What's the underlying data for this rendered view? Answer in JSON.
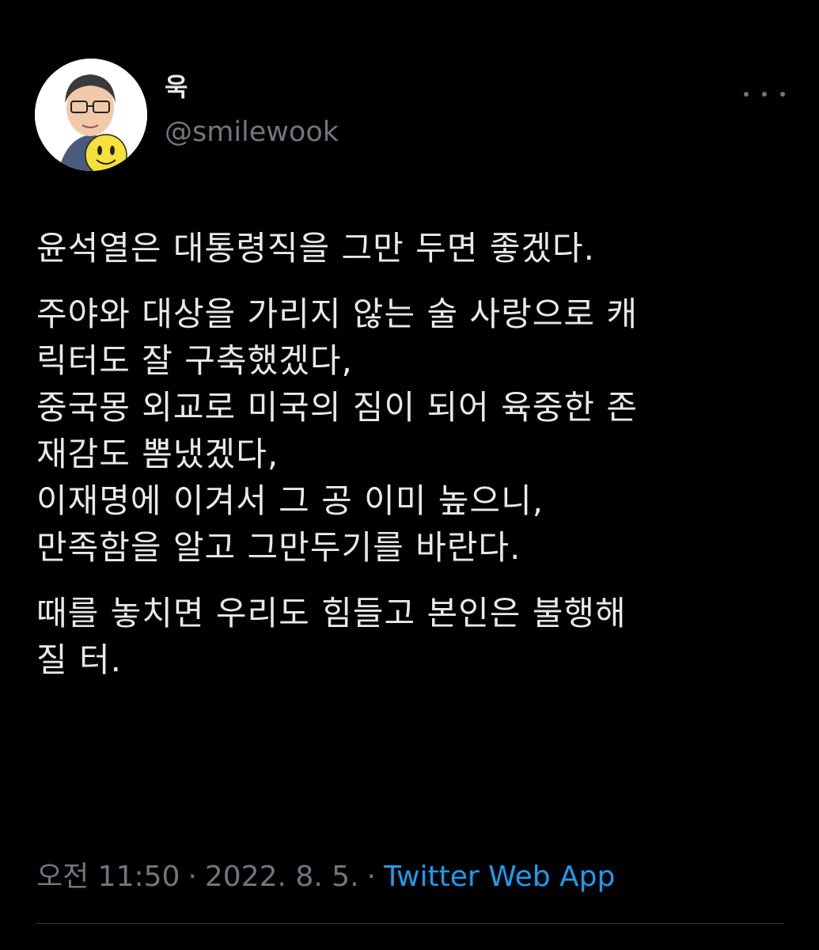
{
  "author": {
    "display_name": "욱",
    "handle": "@smilewook"
  },
  "more_icon": "ellipsis-icon",
  "tweet": {
    "paragraphs": [
      {
        "lines": [
          "윤석열은 대통령직을 그만 두면 좋겠다."
        ]
      },
      {
        "lines": [
          "주야와 대상을 가리지 않는 술 사랑으로 캐",
          "릭터도 잘 구축했겠다,",
          "중국몽 외교로 미국의 짐이 되어 육중한 존",
          "재감도 뽐냈겠다,",
          "이재명에 이겨서 그 공 이미 높으니,",
          "만족함을 알고 그만두기를 바란다."
        ]
      },
      {
        "lines": [
          "때를 놓치면 우리도 힘들고 본인은 불행해",
          "질 터."
        ]
      }
    ]
  },
  "meta": {
    "time": "오전 11:50",
    "separator": "·",
    "date": "2022. 8. 5.",
    "source": "Twitter Web App"
  },
  "colors": {
    "background": "#000000",
    "text": "#e7e9ea",
    "secondary": "#71767b",
    "link": "#1d9bf0"
  }
}
